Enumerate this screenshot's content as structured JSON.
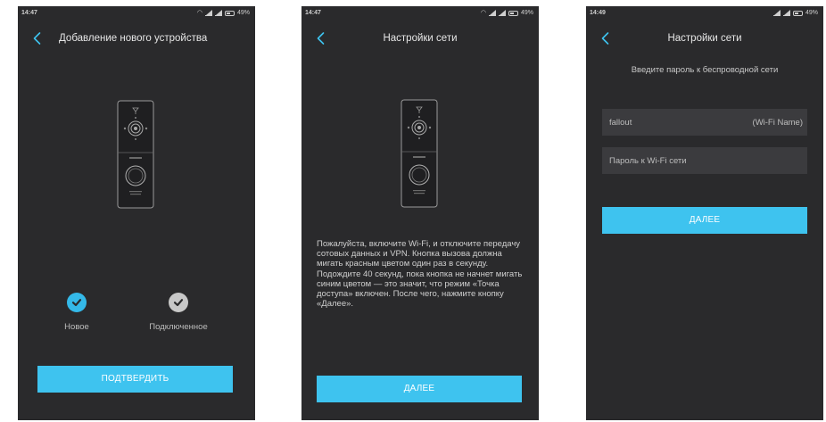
{
  "colors": {
    "screen_bg": "#2a2a2c",
    "accent": "#3ec3ef",
    "check_active": "#34b9e9",
    "check_inactive": "#c8c8c8",
    "field_bg": "#3b3b3e"
  },
  "screens": [
    {
      "status": {
        "time": "14:47",
        "battery": "49%"
      },
      "header": {
        "title": "Добавление нового устройства",
        "back_icon": "chevron-left-icon"
      },
      "device_image": "doorbell-illustration",
      "options": [
        {
          "label": "Новое",
          "icon": "check-circle-icon",
          "selected": true
        },
        {
          "label": "Подключенное",
          "icon": "check-circle-icon",
          "selected": false
        }
      ],
      "button": "ПОДТВЕРДИТЬ"
    },
    {
      "status": {
        "time": "14:47",
        "battery": "49%"
      },
      "header": {
        "title": "Настройки сети",
        "back_icon": "chevron-left-icon"
      },
      "device_image": "doorbell-illustration",
      "instructions": "Пожалуйста, включите Wi-Fi, и отключите передачу сотовых данных и VPN. Кнопка вызова должна мигать красным цветом один раз в секунду. Подождите 40 секунд, пока кнопка не начнет мигать синим цветом — это значит, что режим «Точка доступа» включен. После чего, нажмите кнопку «Далее».",
      "button": "ДАЛЕЕ"
    },
    {
      "status": {
        "time": "14:49",
        "battery": "49%"
      },
      "header": {
        "title": "Настройки сети",
        "back_icon": "chevron-left-icon"
      },
      "subtitle": "Введите пароль к беспроводной сети",
      "wifi_name": {
        "value": "fallout",
        "suffix": "(Wi-Fi Name)"
      },
      "password": {
        "placeholder": "Пароль к Wi-Fi сети"
      },
      "button": "ДАЛЕЕ"
    }
  ]
}
